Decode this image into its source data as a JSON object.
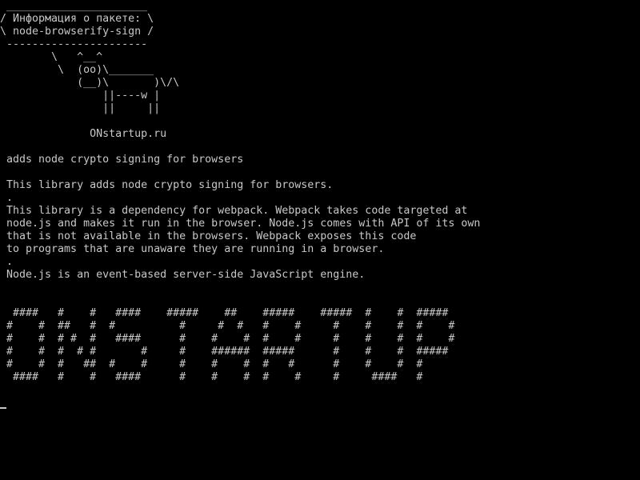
{
  "colors": {
    "background": "#000000",
    "foreground": "#c8c8c8"
  },
  "banner": {
    "top_rule": " ______________________",
    "title_line1": "/ Информация о пакете: \\",
    "title_line2": "\\ node-browserify-sign /",
    "bottom_rule": " ----------------------"
  },
  "cow": [
    "        \\   ^__^",
    "         \\  (oo)\\_______",
    "            (__)\\       )\\/\\",
    "                ||----w |",
    "                ||     ||"
  ],
  "site": "              ONstartup.ru",
  "summary": " adds node crypto signing for browsers",
  "description": [
    " This library adds node crypto signing for browsers.",
    " .",
    " This library is a dependency for webpack. Webpack takes code targeted at",
    " node.js and makes it run in the browser. Node.js comes with API of its own",
    " that is not available in the browsers. Webpack exposes this code",
    " to programs that are unaware they are running in a browser.",
    " .",
    " Node.js is an event-based server-side JavaScript engine."
  ],
  "big_banner": [
    "  ####   #    #   ####    #####    ##    #####    #####  #    #  #####",
    " #    #  ##   #  #          #     #  #   #    #     #    #    #  #    #",
    " #    #  # #  #   ####      #    #    #  #    #     #    #    #  #    #",
    " #    #  #  # #       #     #    ######  #####      #    #    #  #####",
    " #    #  #   ##  #    #     #    #    #  #   #      #    #    #  #",
    "  ####   #    #   ####      #    #    #  #    #     #     ####   #"
  ]
}
